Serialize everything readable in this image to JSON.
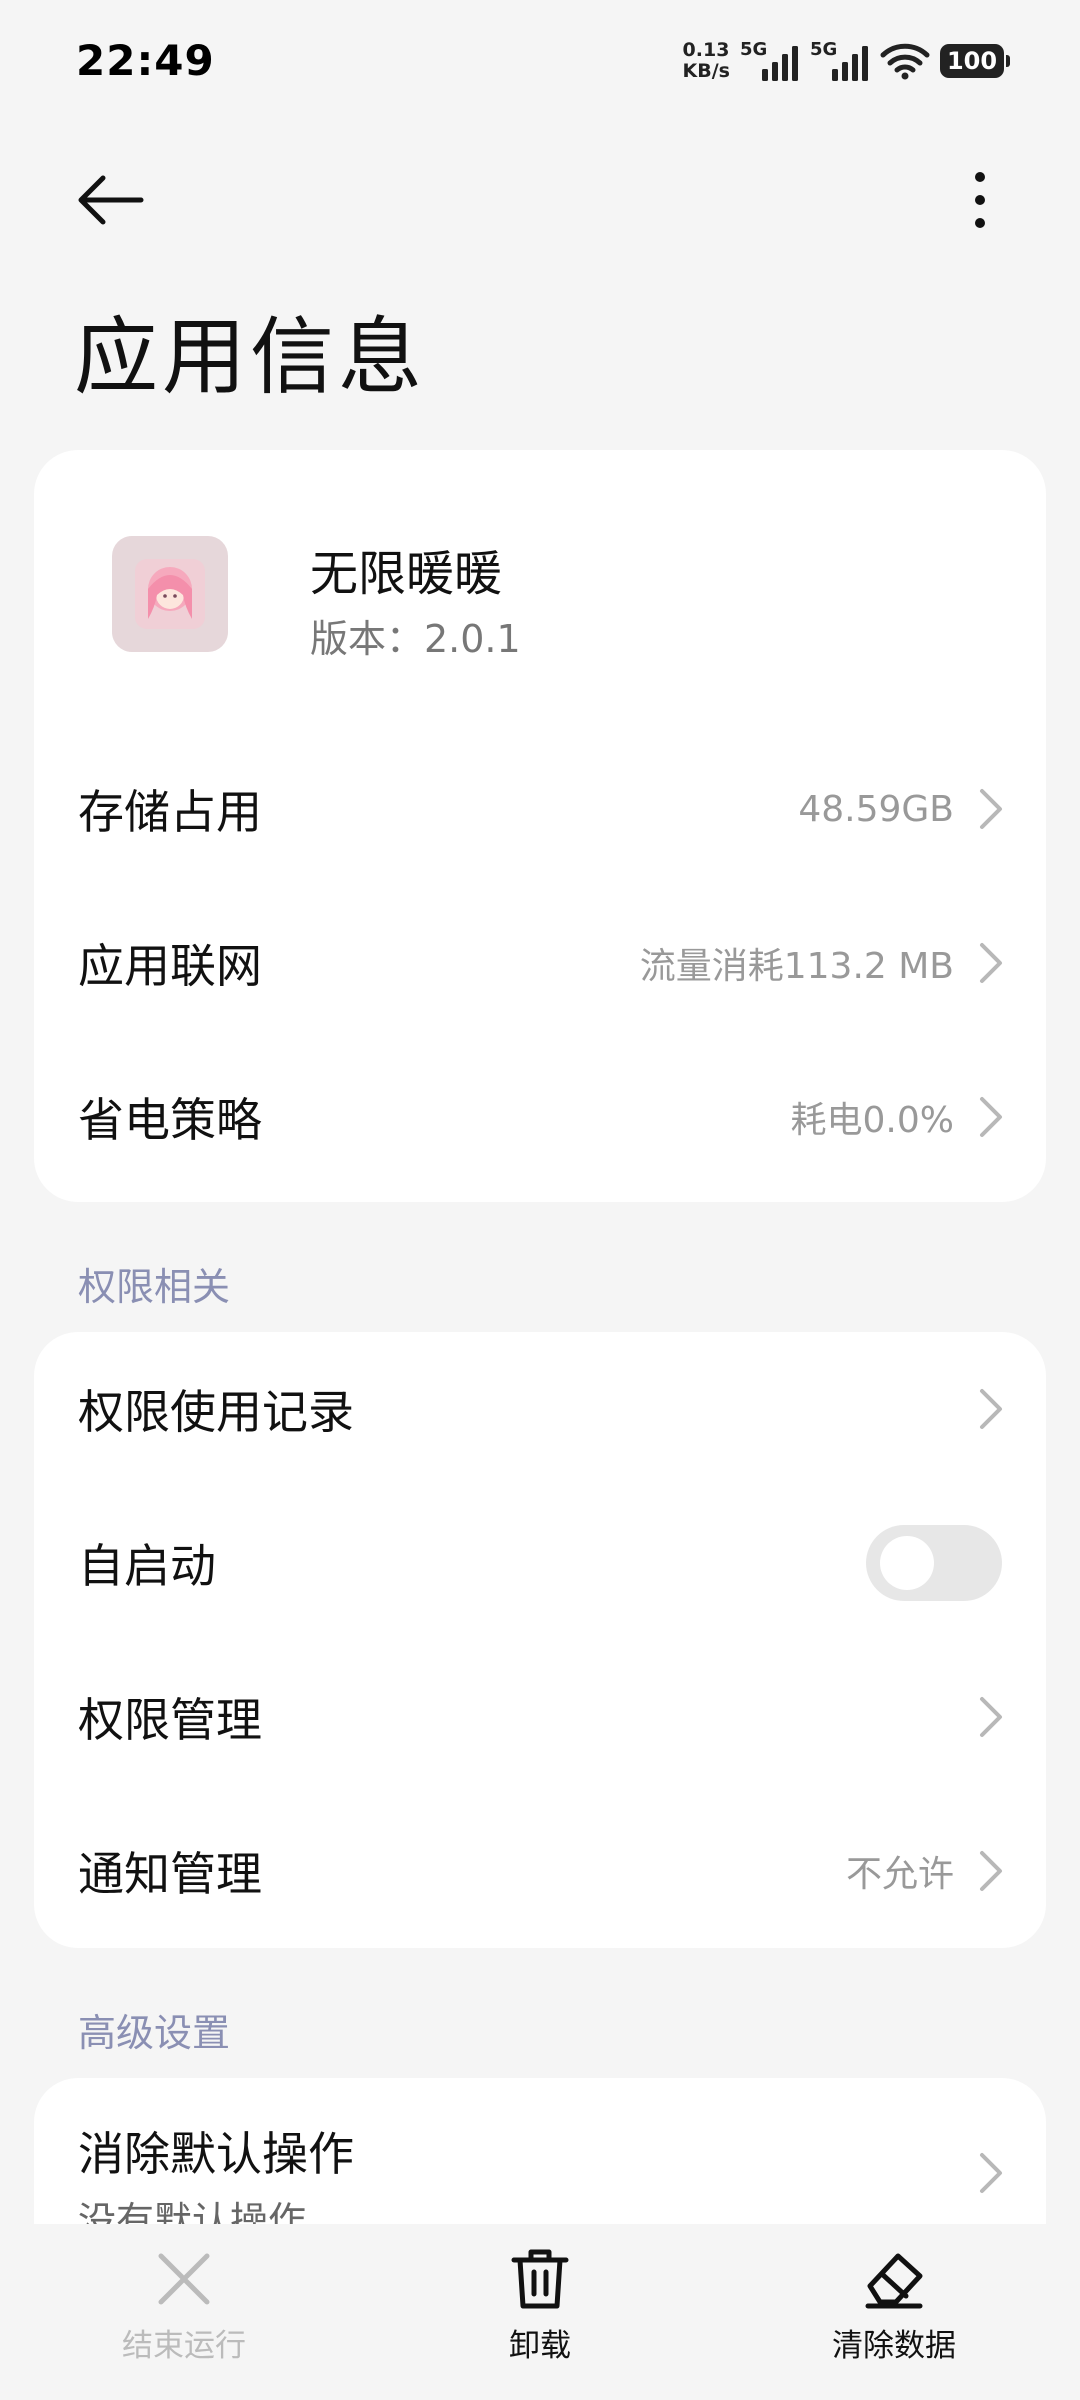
{
  "status_bar": {
    "time": "22:49",
    "net_speed_value": "0.13",
    "net_speed_unit": "KB/s",
    "signal1_label": "5G",
    "signal2_label": "5G",
    "battery": "100"
  },
  "page": {
    "title": "应用信息"
  },
  "app": {
    "name": "无限暖暖",
    "version": "版本：2.0.1"
  },
  "info_rows": [
    {
      "label": "存储占用",
      "value": "48.59GB"
    },
    {
      "label": "应用联网",
      "value": "流量消耗113.2 MB"
    },
    {
      "label": "省电策略",
      "value": "耗电0.0%"
    }
  ],
  "permissions": {
    "section_title": "权限相关",
    "rows": [
      {
        "label": "权限使用记录",
        "value": ""
      },
      {
        "label": "自启动",
        "toggle": false
      },
      {
        "label": "权限管理",
        "value": ""
      },
      {
        "label": "通知管理",
        "value": "不允许"
      }
    ]
  },
  "advanced": {
    "section_title": "高级设置",
    "clear_defaults_label": "消除默认操作",
    "clear_defaults_sub": "没有默认操作"
  },
  "bottom_bar": {
    "force_stop": "结束运行",
    "uninstall": "卸载",
    "clear_data": "清除数据"
  },
  "colors": {
    "background": "#f5f5f5",
    "card": "#ffffff",
    "section_title": "#8a8fb3",
    "secondary_text": "#999999",
    "disabled": "#bbbbbb"
  }
}
